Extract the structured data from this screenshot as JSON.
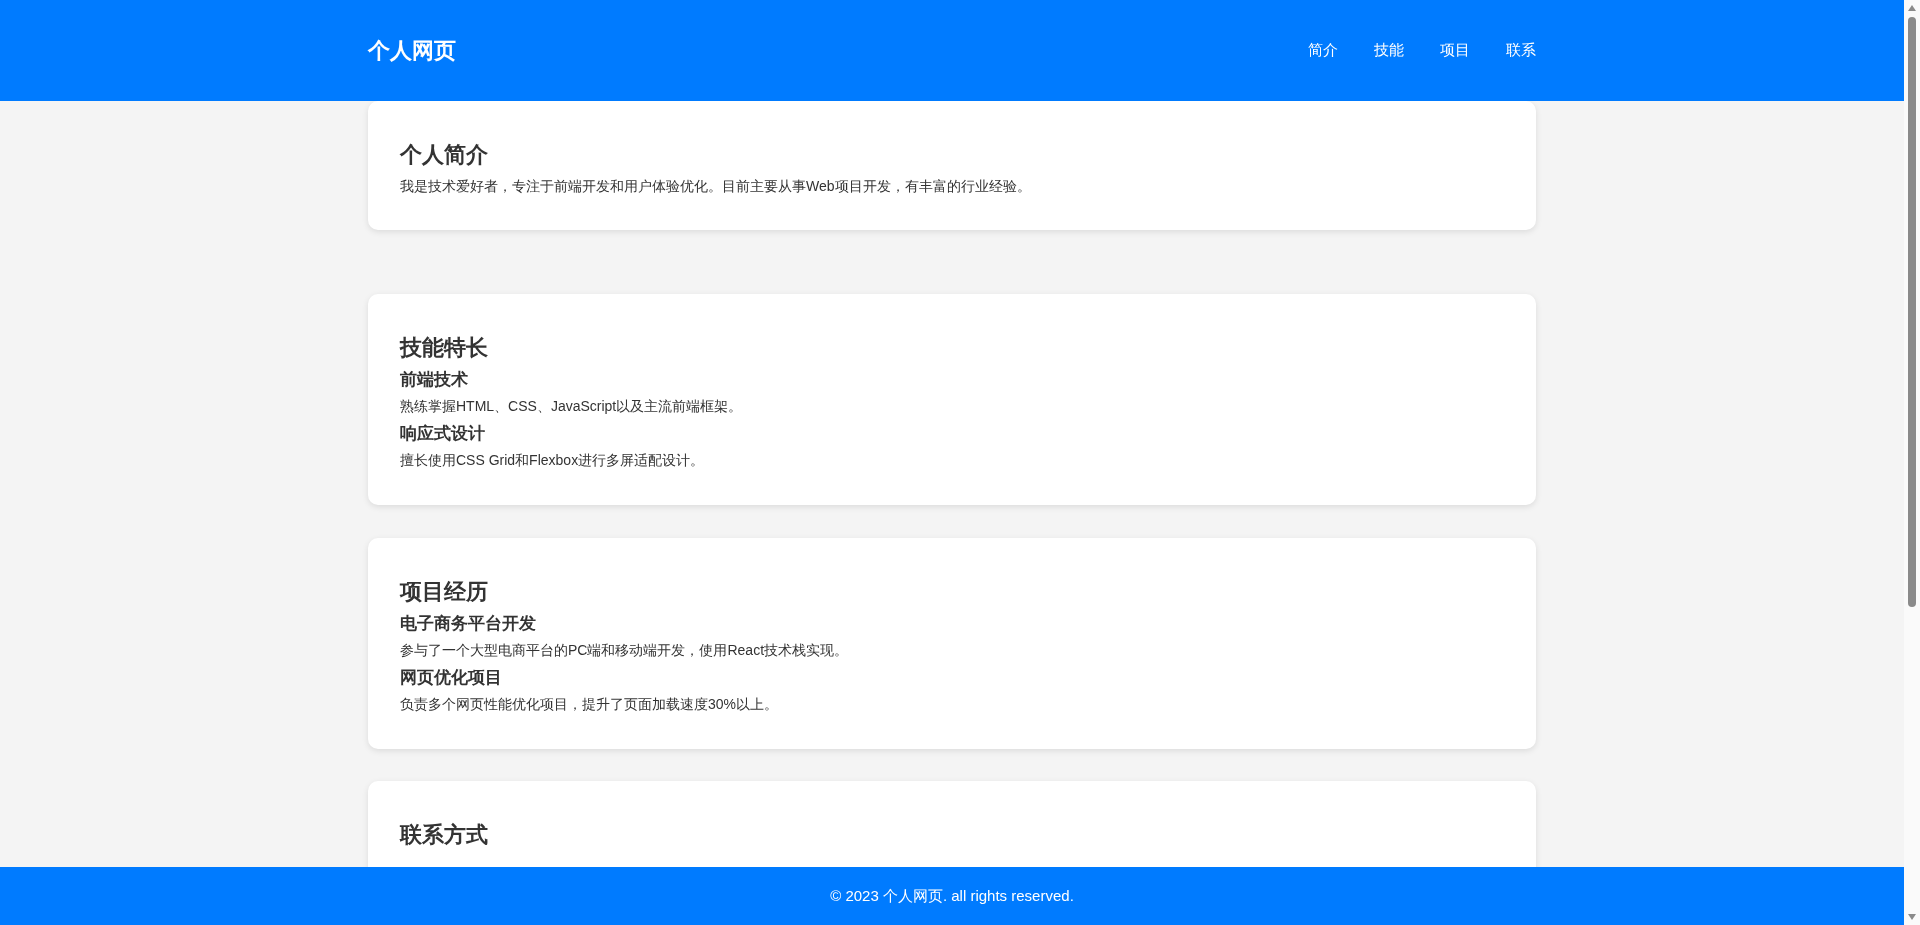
{
  "header": {
    "logo": "个人网页",
    "nav": [
      "简介",
      "技能",
      "项目",
      "联系"
    ]
  },
  "sections": [
    {
      "title": "个人简介",
      "text": "我是技术爱好者，专注于前端开发和用户体验优化。目前主要从事Web项目开发，有丰富的行业经验。"
    },
    {
      "title": "技能特长",
      "items": [
        {
          "heading": "前端技术",
          "text": "熟练掌握HTML、CSS、JavaScript以及主流前端框架。"
        },
        {
          "heading": "响应式设计",
          "text": "擅长使用CSS Grid和Flexbox进行多屏适配设计。"
        }
      ]
    },
    {
      "title": "项目经历",
      "items": [
        {
          "heading": "电子商务平台开发",
          "text": "参与了一个大型电商平台的PC端和移动端开发，使用React技术栈实现。"
        },
        {
          "heading": "网页优化项目",
          "text": "负责多个网页性能优化项目，提升了页面加载速度30%以上。"
        }
      ]
    },
    {
      "title": "联系方式"
    }
  ],
  "footer": "© 2023 个人网页. all rights reserved."
}
